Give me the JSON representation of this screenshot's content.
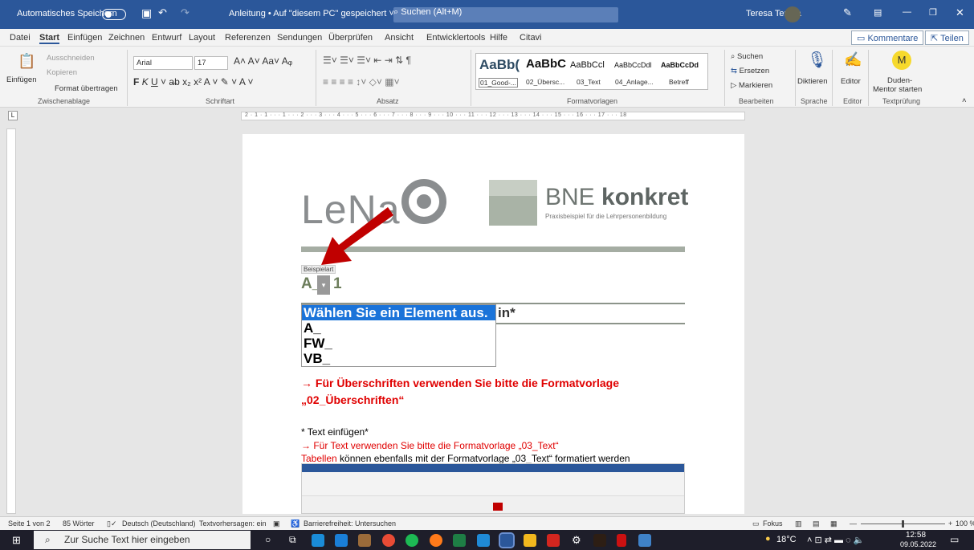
{
  "titlebar": {
    "autosave": "Automatisches Speichern",
    "doc_title": "Anleitung • Auf \"diesem PC\" gespeichert ˅",
    "search": "Suchen (Alt+M)",
    "user": "Teresa Teresa"
  },
  "menu": {
    "items": [
      "Datei",
      "Start",
      "Einfügen",
      "Zeichnen",
      "Entwurf",
      "Layout",
      "Referenzen",
      "Sendungen",
      "Überprüfen",
      "Ansicht",
      "Entwicklertools",
      "Hilfe",
      "Citavi"
    ],
    "comments": "Kommentare",
    "share": "Teilen"
  },
  "ribbon": {
    "clipboard": {
      "paste": "Einfügen",
      "cut": "Ausschneiden",
      "copy": "Kopieren",
      "format": "Format übertragen",
      "label": "Zwischenablage"
    },
    "font": {
      "name": "Arial",
      "size": "17",
      "label": "Schriftart"
    },
    "paragraph": {
      "label": "Absatz"
    },
    "styles": {
      "items": [
        {
          "preview": "AaBb(",
          "name": "01_Good-..."
        },
        {
          "preview": "AaBbC",
          "name": "02_Übersc..."
        },
        {
          "preview": "AaBbCcl",
          "name": "03_Text"
        },
        {
          "preview": "AaBbCcDdl",
          "name": "04_Anlage..."
        },
        {
          "preview": "AaBbCcDd",
          "name": "Betreff"
        }
      ],
      "label": "Formatvorlagen"
    },
    "edit": {
      "search": "Suchen",
      "replace": "Ersetzen",
      "select": "Markieren",
      "label": "Bearbeiten"
    },
    "voice": {
      "dictate": "Diktieren",
      "label": "Sprache"
    },
    "editor": {
      "btn": "Editor",
      "label": "Editor"
    },
    "duden": {
      "btn1": "Duden-",
      "btn2": "Mentor starten",
      "label": "Textprüfung"
    }
  },
  "ruler": "2 · 1 · 1 · · · 1 · · · 2 · · · 3 · · · 4 · · · 5 · · · 6 · · · 7 · · · 8 · · · 9 · · · 10 · · · 11 · · · 12 · · · 13 · · · 14 · · · 15 · · · 16 · · · 17 · · · 18",
  "doc": {
    "logo_left": "LeNa",
    "logo_right_1": "BNE ",
    "logo_right_2": "konkret",
    "logo_sub": "Praxisbeispiel für die Lehrpersonenbildung",
    "cc_label": "Beispielart",
    "cc_value": "A_",
    "cc_num": "1",
    "dropdown": [
      "Wählen Sie ein Element aus.",
      "A_",
      "FW_",
      "VB_"
    ],
    "heading_tail": "in*",
    "note1": "→ Für Überschriften verwenden Sie bitte die Formatvorlage",
    "note2": "„02_Überschriften“",
    "text1": "* Text einfügen*",
    "text2": "→ Für Text verwenden Sie bitte die Formatvorlage „03_Text“",
    "text3a": "Tabellen",
    "text3b": " können ebenfalls mit der Formatvorlage „03_Text“ formatiert werden"
  },
  "status": {
    "page": "Seite 1 von 2",
    "words": "85 Wörter",
    "lang": "Deutsch (Deutschland)",
    "pred": "Textvorhersagen: ein",
    "access": "Barrierefreiheit: Untersuchen",
    "focus": "Fokus",
    "zoom": "100 %"
  },
  "taskbar": {
    "search": "Zur Suche Text hier eingeben",
    "temp": "18°C",
    "time": "12:58",
    "date": "09.05.2022"
  }
}
